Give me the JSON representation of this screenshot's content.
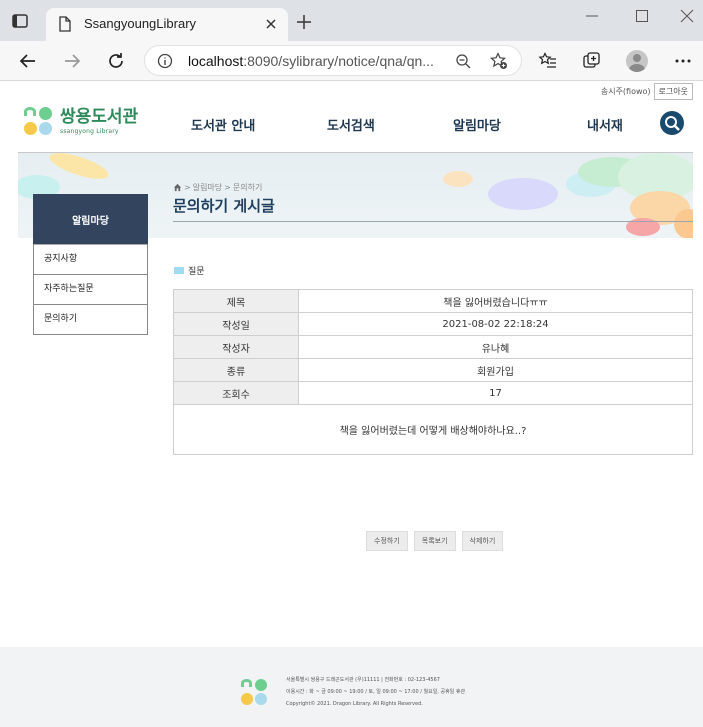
{
  "browser": {
    "tab_title": "SsangyoungLibrary",
    "url_host": "localhost",
    "url_rest": ":8090/sylibrary/notice/qna/qn..."
  },
  "site": {
    "user_label": "송시주(fiowo)",
    "logout_label": "로그아웃",
    "logo_main": "쌍용도서관",
    "logo_sub": "ssangyong Library",
    "nav": [
      "도서관 안내",
      "도서검색",
      "알림마당",
      "내서재"
    ]
  },
  "breadcrumb": [
    "알림마당",
    "문의하기"
  ],
  "page_title": "문의하기 게시글",
  "sidebar": {
    "heading": "알림마당",
    "items": [
      "공지사항",
      "자주하는질문",
      "문의하기"
    ]
  },
  "section_label": "질문",
  "question": {
    "rows": [
      {
        "label": "제목",
        "value": "책을 잃어버렸습니다ㅠㅠ"
      },
      {
        "label": "작성일",
        "value": "2021-08-02 22:18:24"
      },
      {
        "label": "작성자",
        "value": "유나혜"
      },
      {
        "label": "종류",
        "value": "회원가입"
      },
      {
        "label": "조회수",
        "value": "17"
      }
    ],
    "content": "책을 잃어버렸는데 어떻게 배상해야하나요..?"
  },
  "buttons": {
    "edit": "수정하기",
    "list": "목록보기",
    "delete": "삭제하기"
  },
  "footer": {
    "line1": "서울특별시 쌍용구 드래곤도서관 (우)11111 | 전화번호 : 02-123-4567",
    "line2": "이용시간 : 화 ~ 금 09:00 ~ 19:00 / 토, 일 09:00 ~ 17:00 / 월요일, 공휴일 휴관",
    "line3": "Copyright© 2021. Dragon Library. All Rights Reserved."
  },
  "colors": {
    "nav_text": "#1f3850",
    "sidebar_heading_bg": "#33445f",
    "brand_green": "#2e8a5b"
  }
}
